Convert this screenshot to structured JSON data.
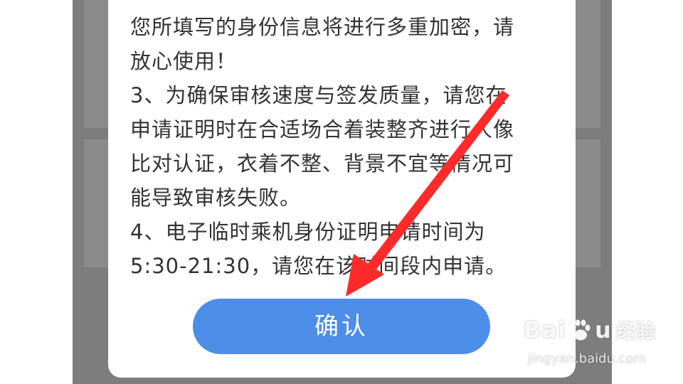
{
  "dialog": {
    "paragraphs": [
      {
        "lines": [
          "您所填写的身份信息将进行多重加密，请",
          "放心使用！"
        ]
      },
      {
        "lines": [
          "3、为确保审核速度与签发质量，请您在",
          "申请证明时在合适场合着装整齐进行人像",
          "比对认证，衣着不整、背景不宜等情况可",
          "能导致审核失败。"
        ]
      },
      {
        "lines": [
          "4、电子临时乘机身份证明申请时间为",
          "5:30-21:30，请您在该时间段内申请。"
        ]
      }
    ],
    "confirm_label": "确认"
  },
  "annotation": {
    "arrow_color": "#ff2a2a",
    "icon": "red-arrow-icon"
  },
  "watermark": {
    "brand_left": "Bai",
    "brand_right": "u",
    "brand_cn": "经验",
    "url": "jingyan.baidu.com",
    "icon": "baidu-paw-icon"
  },
  "colors": {
    "backdrop": "#7d7d7d",
    "dialog": "#ffffff",
    "text": "#333333",
    "button": "#4c8ee8",
    "button_text": "#ffffff"
  }
}
